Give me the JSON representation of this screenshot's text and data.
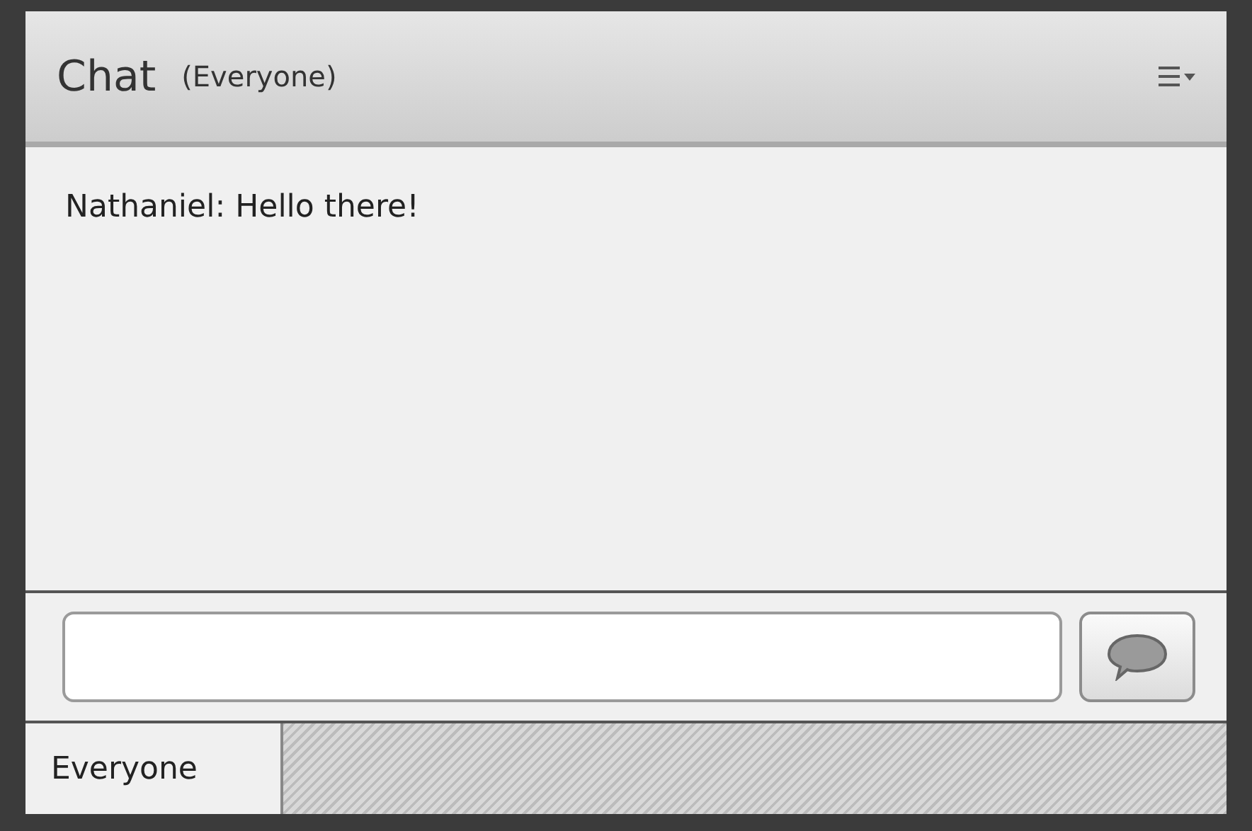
{
  "header": {
    "title": "Chat",
    "subtitle": "(Everyone)"
  },
  "messages": [
    {
      "sender": "Nathaniel:",
      "text": "Hello there!"
    }
  ],
  "tabs": [
    {
      "label": "Everyone",
      "selected": true
    }
  ]
}
